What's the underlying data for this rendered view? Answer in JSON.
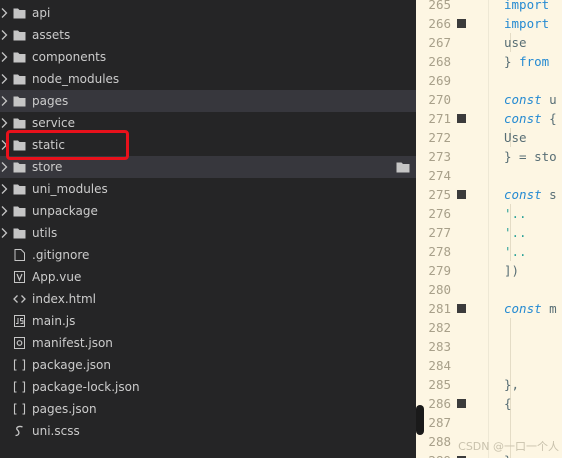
{
  "explorer": {
    "items": [
      {
        "name": "api",
        "type": "folder"
      },
      {
        "name": "assets",
        "type": "folder"
      },
      {
        "name": "components",
        "type": "folder"
      },
      {
        "name": "node_modules",
        "type": "folder"
      },
      {
        "name": "pages",
        "type": "folder",
        "state": "selected"
      },
      {
        "name": "service",
        "type": "folder"
      },
      {
        "name": "static",
        "type": "folder",
        "highlighted": true
      },
      {
        "name": "store",
        "type": "folder",
        "state": "hover"
      },
      {
        "name": "uni_modules",
        "type": "folder"
      },
      {
        "name": "unpackage",
        "type": "folder"
      },
      {
        "name": "utils",
        "type": "folder"
      },
      {
        "name": ".gitignore",
        "type": "file",
        "icon": "gitignore-file-icon"
      },
      {
        "name": "App.vue",
        "type": "file",
        "icon": "vue-file-icon"
      },
      {
        "name": "index.html",
        "type": "file",
        "icon": "html-file-icon"
      },
      {
        "name": "main.js",
        "type": "file",
        "icon": "js-file-icon"
      },
      {
        "name": "manifest.json",
        "type": "file",
        "icon": "manifest-file-icon"
      },
      {
        "name": "package.json",
        "type": "file",
        "icon": "json-file-icon"
      },
      {
        "name": "package-lock.json",
        "type": "file",
        "icon": "json-file-icon"
      },
      {
        "name": "pages.json",
        "type": "file",
        "icon": "json-file-icon"
      },
      {
        "name": "uni.scss",
        "type": "file",
        "icon": "scss-file-icon"
      }
    ],
    "hover_action_icon": "new-folder-icon"
  },
  "editor": {
    "lines": [
      {
        "num": "265",
        "fold": false,
        "code": "import"
      },
      {
        "num": "266",
        "fold": true,
        "code": "import"
      },
      {
        "num": "267",
        "fold": false,
        "code": "   use"
      },
      {
        "num": "268",
        "fold": false,
        "code": "} from"
      },
      {
        "num": "269",
        "fold": false,
        "code": ""
      },
      {
        "num": "270",
        "fold": false,
        "code": "const u"
      },
      {
        "num": "271",
        "fold": true,
        "code": "const {"
      },
      {
        "num": "272",
        "fold": false,
        "code": "   Use"
      },
      {
        "num": "273",
        "fold": false,
        "code": "} = sto"
      },
      {
        "num": "274",
        "fold": false,
        "code": ""
      },
      {
        "num": "275",
        "fold": true,
        "code": "const s"
      },
      {
        "num": "276",
        "fold": false,
        "code": "   '.."
      },
      {
        "num": "277",
        "fold": false,
        "code": "   '.."
      },
      {
        "num": "278",
        "fold": false,
        "code": "   '.."
      },
      {
        "num": "279",
        "fold": false,
        "code": "])"
      },
      {
        "num": "280",
        "fold": false,
        "code": ""
      },
      {
        "num": "281",
        "fold": true,
        "code": "const m"
      },
      {
        "num": "282",
        "fold": false,
        "code": ""
      },
      {
        "num": "283",
        "fold": false,
        "code": ""
      },
      {
        "num": "284",
        "fold": false,
        "code": ""
      },
      {
        "num": "285",
        "fold": false,
        "code": "   },"
      },
      {
        "num": "286",
        "fold": true,
        "code": "   {"
      },
      {
        "num": "287",
        "fold": false,
        "code": ""
      },
      {
        "num": "288",
        "fold": false,
        "code": ""
      },
      {
        "num": "289",
        "fold": true,
        "code": "   }"
      }
    ]
  },
  "watermark": "CSDN @一口一个人"
}
